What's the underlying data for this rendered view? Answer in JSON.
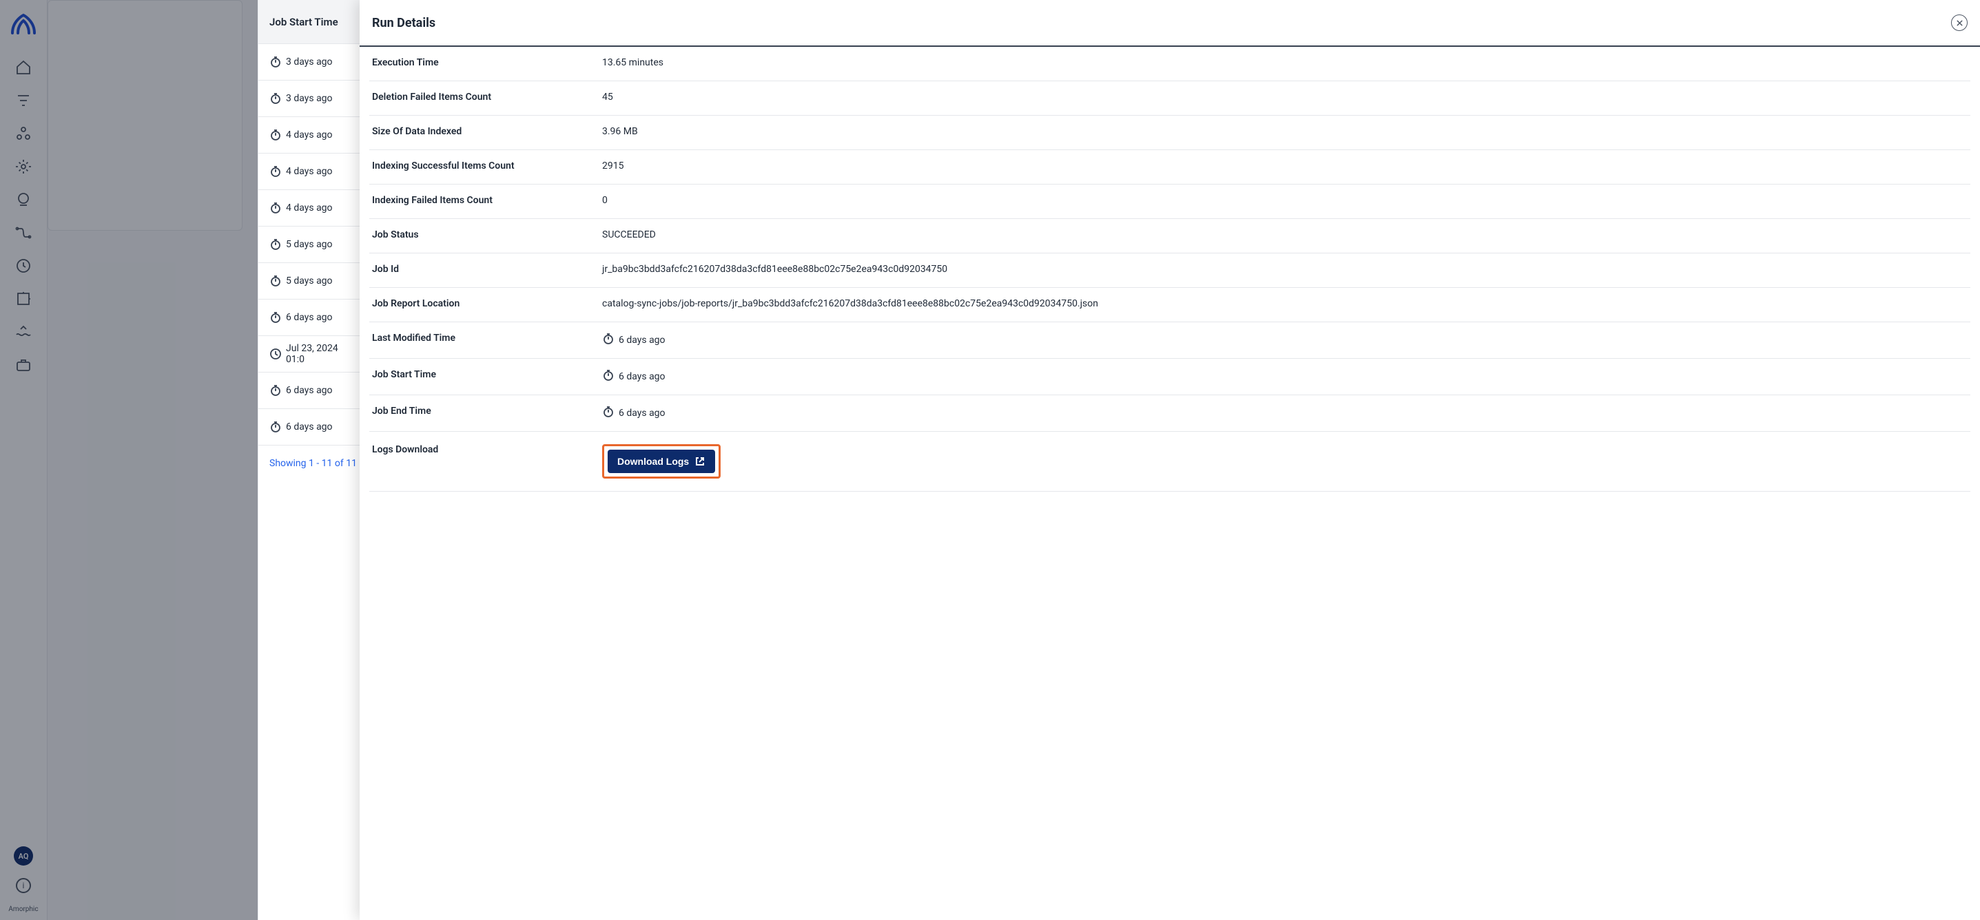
{
  "sidebar": {
    "brand": "Amorphic",
    "avatar": "AQ"
  },
  "table": {
    "header": "Job Start Time",
    "rows": [
      {
        "text": "3 days ago",
        "icon": "stopwatch"
      },
      {
        "text": "3 days ago",
        "icon": "stopwatch"
      },
      {
        "text": "4 days ago",
        "icon": "stopwatch"
      },
      {
        "text": "4 days ago",
        "icon": "stopwatch"
      },
      {
        "text": "4 days ago",
        "icon": "stopwatch"
      },
      {
        "text": "5 days ago",
        "icon": "stopwatch"
      },
      {
        "text": "5 days ago",
        "icon": "stopwatch"
      },
      {
        "text": "6 days ago",
        "icon": "stopwatch"
      },
      {
        "text": "Jul 23, 2024 01:0",
        "icon": "clock"
      },
      {
        "text": "6 days ago",
        "icon": "stopwatch"
      },
      {
        "text": "6 days ago",
        "icon": "stopwatch"
      }
    ],
    "footer": "Showing 1 - 11 of 11"
  },
  "panel": {
    "title": "Run Details",
    "rows": [
      {
        "label": "Execution Time",
        "value": "13.65 minutes"
      },
      {
        "label": "Deletion Failed Items Count",
        "value": "45"
      },
      {
        "label": "Size Of Data Indexed",
        "value": "3.96 MB"
      },
      {
        "label": "Indexing Successful Items Count",
        "value": "2915"
      },
      {
        "label": "Indexing Failed Items Count",
        "value": "0"
      },
      {
        "label": "Job Status",
        "value": "SUCCEEDED"
      },
      {
        "label": "Job Id",
        "value": "jr_ba9bc3bdd3afcfc216207d38da3cfd81eee8e88bc02c75e2ea943c0d92034750"
      },
      {
        "label": "Job Report Location",
        "value": "catalog-sync-jobs/job-reports/jr_ba9bc3bdd3afcfc216207d38da3cfd81eee8e88bc02c75e2ea943c0d92034750.json"
      },
      {
        "label": "Last Modified Time",
        "value": "6 days ago",
        "icon": true
      },
      {
        "label": "Job Start Time",
        "value": "6 days ago",
        "icon": true
      },
      {
        "label": "Job End Time",
        "value": "6 days ago",
        "icon": true
      }
    ],
    "download_label": "Logs Download",
    "download_btn": "Download Logs"
  }
}
